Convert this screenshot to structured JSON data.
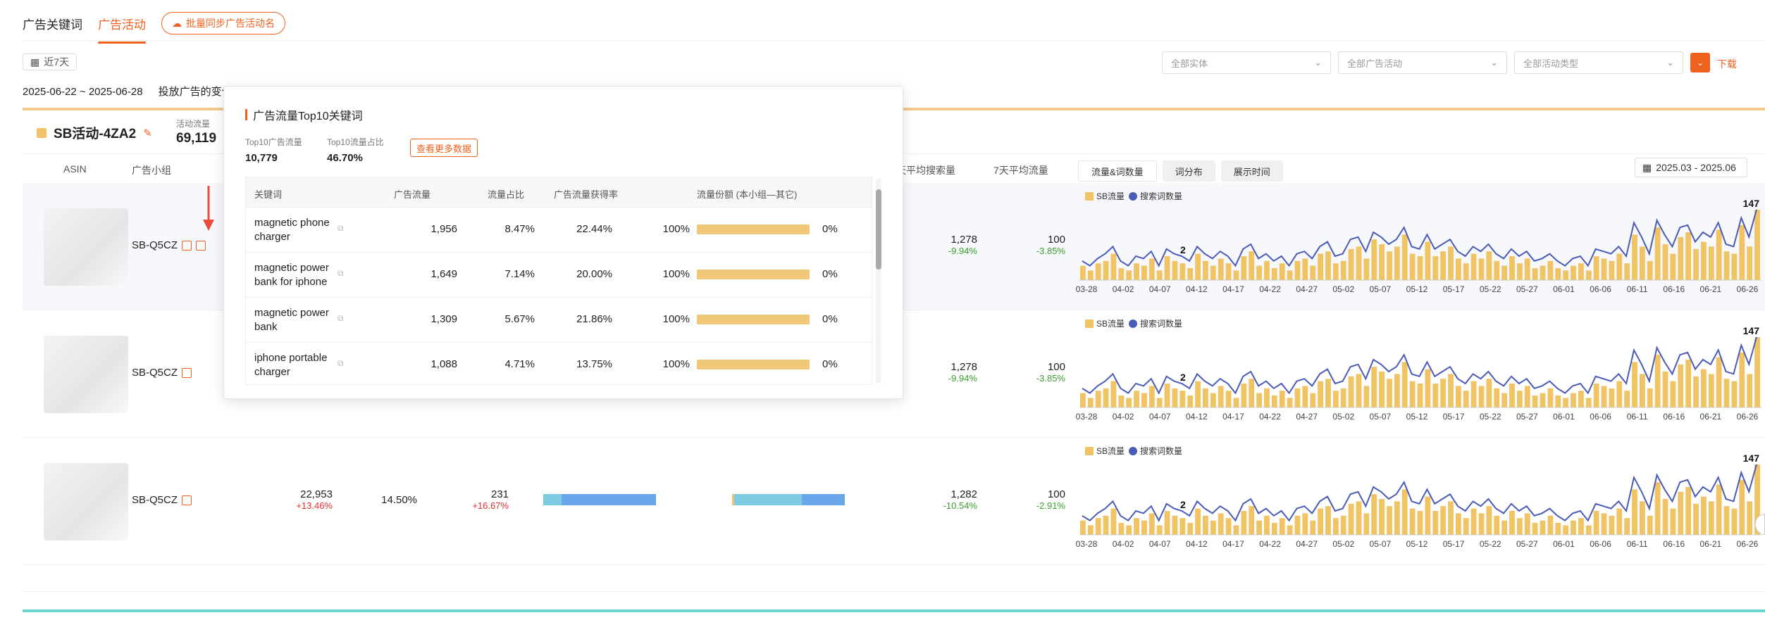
{
  "tabs": [
    {
      "label": "广告关键词"
    },
    {
      "label": "广告活动"
    }
  ],
  "sync_button": "批量同步广告活动名",
  "range_pill": "近7天",
  "filters": {
    "entity": "全部实体",
    "campaign": "全部广告活动",
    "campaign_type": "全部活动类型",
    "download_label": "下载"
  },
  "date_range": "2025-06-22 ~ 2025-06-28",
  "date_note": "投放广告的变化",
  "campaign": {
    "name": "SB活动-4ZA2",
    "metric_label": "活动流量",
    "metric_value": "69,119"
  },
  "columns": {
    "asin": "ASIN",
    "group": "广告小组",
    "avg_search": "天平均搜索量",
    "avg_traffic": "7天平均流量"
  },
  "chart_tabs": [
    "流量&词数量",
    "词分布",
    "展示时间"
  ],
  "chart_date": "2025.03 - 2025.06",
  "rows": [
    {
      "group": "SB-Q5CZ",
      "search": "1,278",
      "search_chg": "-9.94%",
      "traffic": "100",
      "traffic_chg": "-3.85%"
    },
    {
      "group": "SB-Q5CZ",
      "search": "1,278",
      "search_chg": "-9.94%",
      "traffic": "100",
      "traffic_chg": "-3.85%"
    },
    {
      "group": "SB-Q5CZ",
      "v1": "22,953",
      "v1_chg": "+13.46%",
      "v2": "14.50%",
      "v3": "231",
      "v3_chg": "+16.67%",
      "search": "1,282",
      "search_chg": "-10.54%",
      "traffic": "100",
      "traffic_chg": "-2.91%"
    }
  ],
  "popup": {
    "title": "广告流量Top10关键词",
    "stat1_label": "Top10广告流量",
    "stat1_value": "10,779",
    "stat2_label": "Top10流量占比",
    "stat2_value": "46.70%",
    "more_button": "查看更多数据",
    "headers": [
      "关键词",
      "广告流量",
      "流量占比",
      "广告流量获得率",
      "流量份额 (本小组—其它)"
    ],
    "rows": [
      {
        "kw": "magnetic phone charger",
        "traffic": "1,956",
        "ratio": "8.47%",
        "rate": "22.44%",
        "own": "100%",
        "other": "0%"
      },
      {
        "kw": "magnetic power bank for iphone",
        "traffic": "1,649",
        "ratio": "7.14%",
        "rate": "20.00%",
        "own": "100%",
        "other": "0%"
      },
      {
        "kw": "magnetic power bank",
        "traffic": "1,309",
        "ratio": "5.67%",
        "rate": "21.86%",
        "own": "100%",
        "other": "0%"
      },
      {
        "kw": "iphone portable charger",
        "traffic": "1,088",
        "ratio": "4.71%",
        "rate": "13.75%",
        "own": "100%",
        "other": "0%"
      }
    ]
  },
  "chart_data": [
    {
      "type": "bar",
      "legend": [
        "SB流量",
        "搜索词数量"
      ],
      "colors": {
        "bar": "#f0c464",
        "line": "#4a5bb8"
      },
      "x_ticks": [
        "03-28",
        "04-02",
        "04-07",
        "04-12",
        "04-17",
        "04-22",
        "04-27",
        "05-02",
        "05-07",
        "05-12",
        "05-17",
        "05-22",
        "05-27",
        "06-01",
        "06-06",
        "06-11",
        "06-16",
        "06-21",
        "06-26"
      ],
      "annotations": {
        "max": "147",
        "min": "2"
      },
      "bar_values": [
        30,
        20,
        35,
        40,
        55,
        25,
        20,
        35,
        30,
        45,
        20,
        50,
        40,
        35,
        25,
        55,
        40,
        30,
        45,
        35,
        20,
        50,
        60,
        30,
        40,
        25,
        35,
        20,
        40,
        45,
        30,
        55,
        60,
        35,
        40,
        65,
        70,
        45,
        85,
        75,
        60,
        70,
        95,
        55,
        50,
        80,
        50,
        60,
        70,
        45,
        35,
        55,
        45,
        60,
        40,
        30,
        50,
        35,
        45,
        25,
        30,
        40,
        25,
        20,
        30,
        35,
        20,
        50,
        45,
        40,
        55,
        35,
        95,
        70,
        40,
        110,
        75,
        55,
        90,
        100,
        65,
        80,
        70,
        105,
        60,
        55,
        115,
        70,
        147
      ],
      "line_values": [
        40,
        30,
        45,
        55,
        70,
        40,
        30,
        50,
        45,
        60,
        30,
        65,
        55,
        50,
        40,
        70,
        55,
        45,
        60,
        50,
        30,
        65,
        75,
        45,
        55,
        40,
        50,
        30,
        55,
        60,
        45,
        70,
        80,
        50,
        55,
        85,
        90,
        60,
        100,
        90,
        75,
        85,
        110,
        70,
        65,
        95,
        65,
        75,
        85,
        60,
        50,
        70,
        60,
        75,
        55,
        45,
        65,
        50,
        60,
        40,
        45,
        55,
        40,
        30,
        45,
        50,
        30,
        65,
        60,
        55,
        70,
        50,
        120,
        90,
        55,
        125,
        95,
        70,
        110,
        115,
        80,
        100,
        90,
        120,
        75,
        70,
        130,
        90,
        147
      ]
    },
    {
      "type": "bar",
      "legend": [
        "SB流量",
        "搜索词数量"
      ],
      "colors": {
        "bar": "#f0c464",
        "line": "#4a5bb8"
      },
      "x_ticks": [
        "03-28",
        "04-02",
        "04-07",
        "04-12",
        "04-17",
        "04-22",
        "04-27",
        "05-02",
        "05-07",
        "05-12",
        "05-17",
        "05-22",
        "05-27",
        "06-01",
        "06-06",
        "06-11",
        "06-16",
        "06-21",
        "06-26"
      ],
      "annotations": {
        "max": "147",
        "min": "2"
      },
      "bar_values": [
        30,
        20,
        35,
        40,
        55,
        25,
        20,
        35,
        30,
        45,
        20,
        50,
        40,
        35,
        25,
        55,
        40,
        30,
        45,
        35,
        20,
        50,
        60,
        30,
        40,
        25,
        35,
        20,
        40,
        45,
        30,
        55,
        60,
        35,
        40,
        65,
        70,
        45,
        85,
        75,
        60,
        70,
        95,
        55,
        50,
        80,
        50,
        60,
        70,
        45,
        35,
        55,
        45,
        60,
        40,
        30,
        50,
        35,
        45,
        25,
        30,
        40,
        25,
        20,
        30,
        35,
        20,
        50,
        45,
        40,
        55,
        35,
        95,
        70,
        40,
        110,
        75,
        55,
        90,
        100,
        65,
        80,
        70,
        105,
        60,
        55,
        115,
        70,
        147
      ],
      "line_values": [
        40,
        30,
        45,
        55,
        70,
        40,
        30,
        50,
        45,
        60,
        30,
        65,
        55,
        50,
        40,
        70,
        55,
        45,
        60,
        50,
        30,
        65,
        75,
        45,
        55,
        40,
        50,
        30,
        55,
        60,
        45,
        70,
        80,
        50,
        55,
        85,
        90,
        60,
        100,
        90,
        75,
        85,
        110,
        70,
        65,
        95,
        65,
        75,
        85,
        60,
        50,
        70,
        60,
        75,
        55,
        45,
        65,
        50,
        60,
        40,
        45,
        55,
        40,
        30,
        45,
        50,
        30,
        65,
        60,
        55,
        70,
        50,
        120,
        90,
        55,
        125,
        95,
        70,
        110,
        115,
        80,
        100,
        90,
        120,
        75,
        70,
        130,
        90,
        147
      ]
    },
    {
      "type": "bar",
      "legend": [
        "SB流量",
        "搜索词数量"
      ],
      "colors": {
        "bar": "#f0c464",
        "line": "#4a5bb8"
      },
      "x_ticks": [
        "03-28",
        "04-02",
        "04-07",
        "04-12",
        "04-17",
        "04-22",
        "04-27",
        "05-02",
        "05-07",
        "05-12",
        "05-17",
        "05-22",
        "05-27",
        "06-01",
        "06-06",
        "06-11",
        "06-16",
        "06-21",
        "06-26"
      ],
      "annotations": {
        "max": "147",
        "min": "2"
      },
      "bar_values": [
        30,
        20,
        35,
        40,
        55,
        25,
        20,
        35,
        30,
        45,
        20,
        50,
        40,
        35,
        25,
        55,
        40,
        30,
        45,
        35,
        20,
        50,
        60,
        30,
        40,
        25,
        35,
        20,
        40,
        45,
        30,
        55,
        60,
        35,
        40,
        65,
        70,
        45,
        85,
        75,
        60,
        70,
        95,
        55,
        50,
        80,
        50,
        60,
        70,
        45,
        35,
        55,
        45,
        60,
        40,
        30,
        50,
        35,
        45,
        25,
        30,
        40,
        25,
        20,
        30,
        35,
        20,
        50,
        45,
        40,
        55,
        35,
        95,
        70,
        40,
        110,
        75,
        55,
        90,
        100,
        65,
        80,
        70,
        105,
        60,
        55,
        115,
        70,
        147
      ],
      "line_values": [
        40,
        30,
        45,
        55,
        70,
        40,
        30,
        50,
        45,
        60,
        30,
        65,
        55,
        50,
        40,
        70,
        55,
        45,
        60,
        50,
        30,
        65,
        75,
        45,
        55,
        40,
        50,
        30,
        55,
        60,
        45,
        70,
        80,
        50,
        55,
        85,
        90,
        60,
        100,
        90,
        75,
        85,
        110,
        70,
        65,
        95,
        65,
        75,
        85,
        60,
        50,
        70,
        60,
        75,
        55,
        45,
        65,
        50,
        60,
        40,
        45,
        55,
        40,
        30,
        45,
        50,
        30,
        65,
        60,
        55,
        70,
        50,
        120,
        90,
        55,
        125,
        95,
        70,
        110,
        115,
        80,
        100,
        90,
        120,
        75,
        70,
        130,
        90,
        147
      ]
    }
  ]
}
